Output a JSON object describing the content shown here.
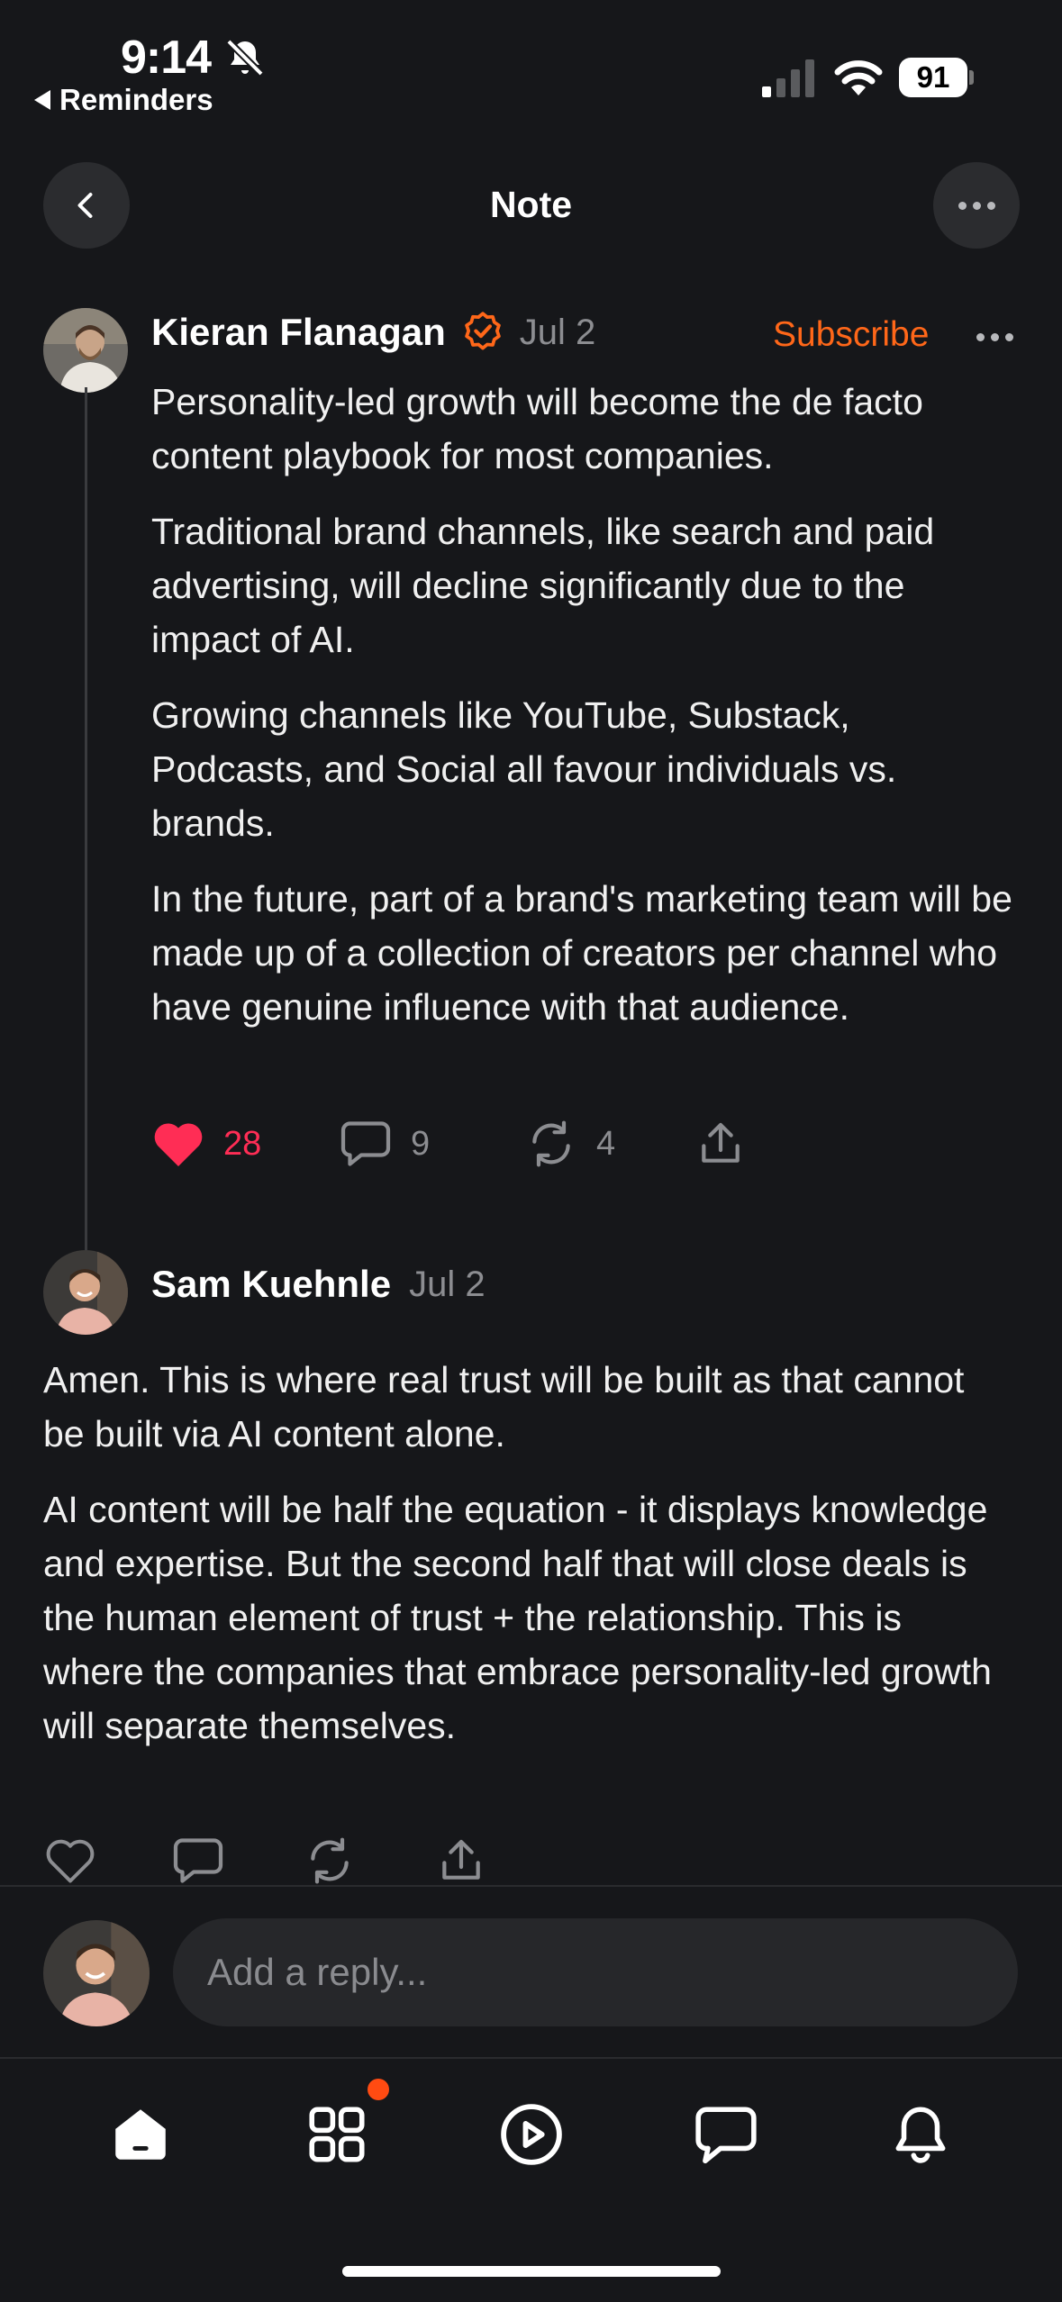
{
  "status_bar": {
    "time": "9:14",
    "back_app_label": "Reminders",
    "battery": "91"
  },
  "nav": {
    "title": "Note"
  },
  "post": {
    "author": "Kieran Flanagan",
    "date": "Jul 2",
    "subscribe_label": "Subscribe",
    "paragraphs": [
      "Personality-led growth will become the de facto content playbook for most companies.",
      "Traditional brand channels, like search and paid advertising, will decline significantly due to the impact of AI.",
      "Growing channels like YouTube, Substack, Podcasts, and Social all favour individuals vs. brands.",
      "In the future, part of a brand's marketing team will be made up of a collection of creators per channel who have genuine influence with that audience."
    ],
    "likes": "28",
    "comments": "9",
    "restacks": "4"
  },
  "reply": {
    "author": "Sam Kuehnle",
    "date": "Jul 2",
    "paragraphs": [
      "Amen. This is where real trust will be built as that cannot be built via AI content alone.",
      "AI content will be half the equation - it displays knowledge and expertise. But the second half that will close deals is the human element of trust + the relationship. This is where the companies that embrace personality-led growth will separate themselves."
    ]
  },
  "composer": {
    "placeholder": "Add a reply..."
  },
  "colors": {
    "accent": "#ff6719",
    "like": "#ff2d55",
    "background": "#16171a"
  },
  "icons": [
    "bell-slash-icon",
    "signal-icon",
    "wifi-icon",
    "chevron-left-icon",
    "ellipsis-icon",
    "verified-icon",
    "heart-icon",
    "comment-icon",
    "restack-icon",
    "share-icon",
    "home-icon",
    "grid-icon",
    "play-icon",
    "chat-icon",
    "bell-icon"
  ]
}
